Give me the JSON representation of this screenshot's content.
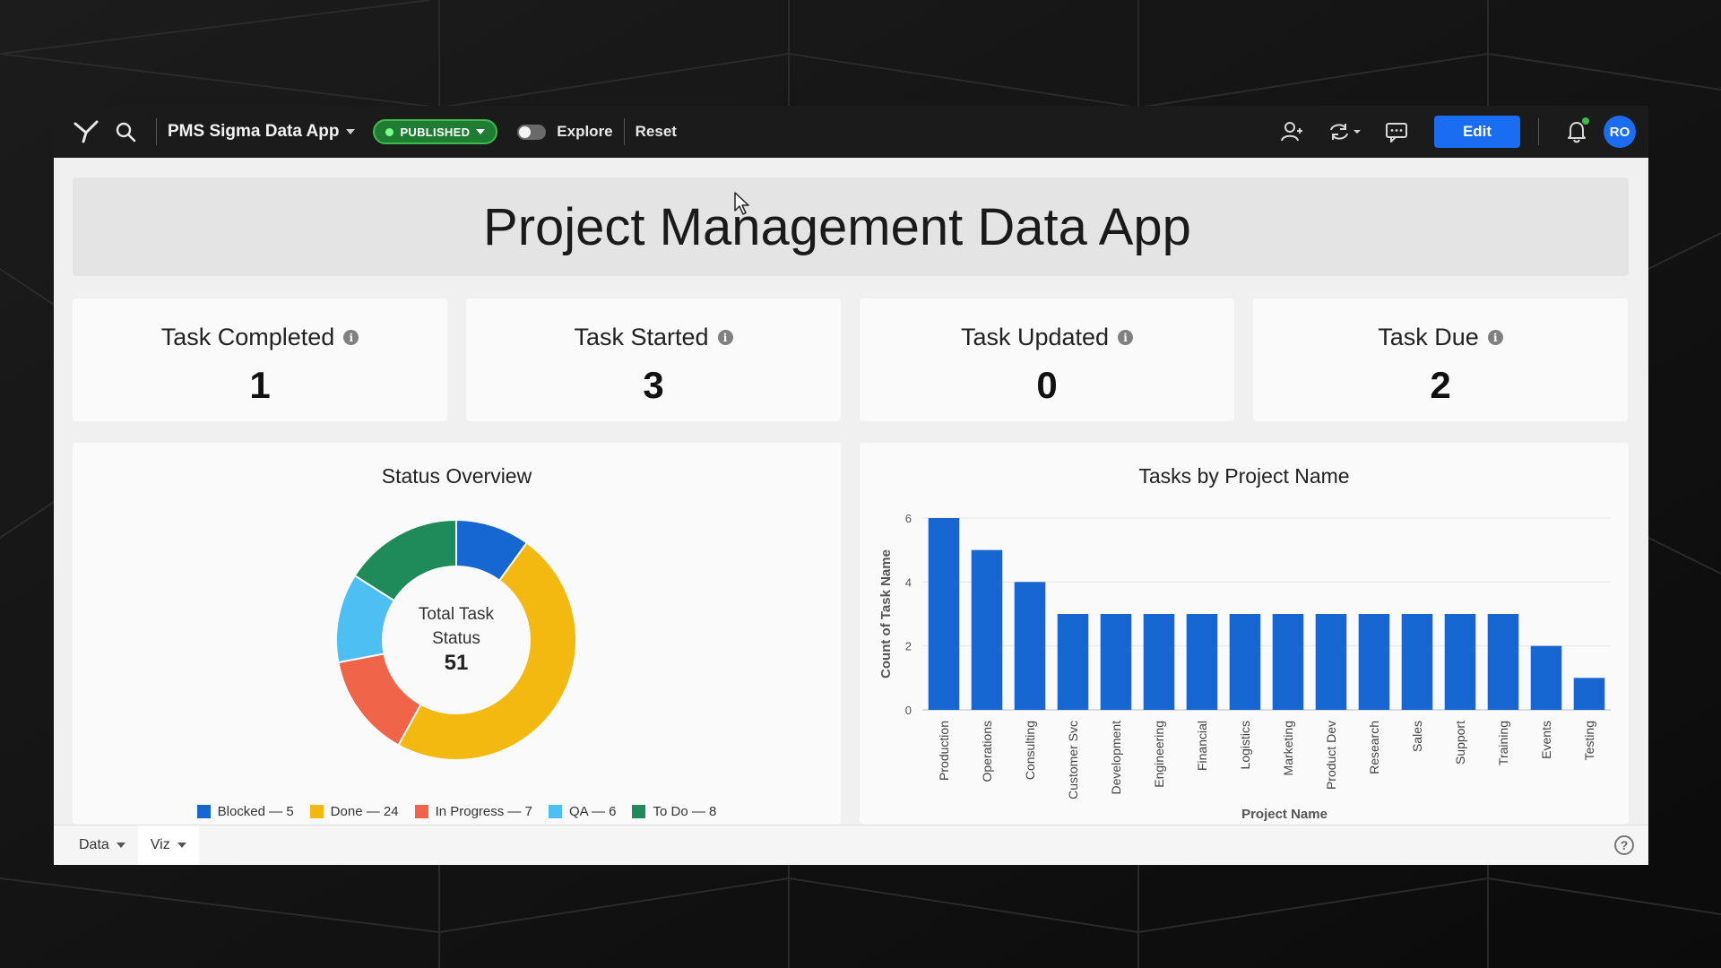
{
  "topbar": {
    "app_name": "PMS Sigma Data App",
    "published_label": "PUBLISHED",
    "explore_label": "Explore",
    "reset_label": "Reset",
    "edit_label": "Edit",
    "avatar_initials": "RO"
  },
  "page": {
    "title": "Project Management Data App"
  },
  "kpis": [
    {
      "title": "Task Completed",
      "value": "1"
    },
    {
      "title": "Task Started",
      "value": "3"
    },
    {
      "title": "Task Updated",
      "value": "0"
    },
    {
      "title": "Task Due",
      "value": "2"
    }
  ],
  "donut_panel": {
    "title": "Status Overview",
    "center_line1": "Total Task",
    "center_line2": "Status",
    "center_value": "51"
  },
  "bar_panel": {
    "title": "Tasks by Project Name"
  },
  "bottom_tabs": [
    {
      "label": "Data"
    },
    {
      "label": "Viz"
    }
  ],
  "chart_data": [
    {
      "type": "pie",
      "title": "Status Overview",
      "labels": [
        "Blocked",
        "Done",
        "In Progress",
        "QA",
        "To Do"
      ],
      "values": [
        5,
        24,
        7,
        6,
        8
      ],
      "legend_labels": [
        "Blocked — 5",
        "Done — 24",
        "In Progress — 7",
        "QA — 6",
        "To Do — 8"
      ],
      "colors": [
        "#1767d2",
        "#f4b911",
        "#f06449",
        "#4dbff2",
        "#1f8a5a"
      ],
      "donut": true,
      "center_text": "Total Task Status 51",
      "legend": "bottom"
    },
    {
      "type": "bar",
      "title": "Tasks by Project Name",
      "categories": [
        "Production",
        "Operations",
        "Consulting",
        "Customer Svc",
        "Development",
        "Engineering",
        "Financial",
        "Logistics",
        "Marketing",
        "Product Dev",
        "Research",
        "Sales",
        "Support",
        "Training",
        "Events",
        "Testing"
      ],
      "values": [
        6,
        5,
        4,
        3,
        3,
        3,
        3,
        3,
        3,
        3,
        3,
        3,
        3,
        3,
        2,
        1
      ],
      "xlabel": "Project Name",
      "ylabel": "Count of Task Name",
      "ylim": [
        0,
        6
      ],
      "yticks": [
        0,
        2,
        4,
        6
      ],
      "grid": true,
      "color": "#1767d2"
    }
  ]
}
